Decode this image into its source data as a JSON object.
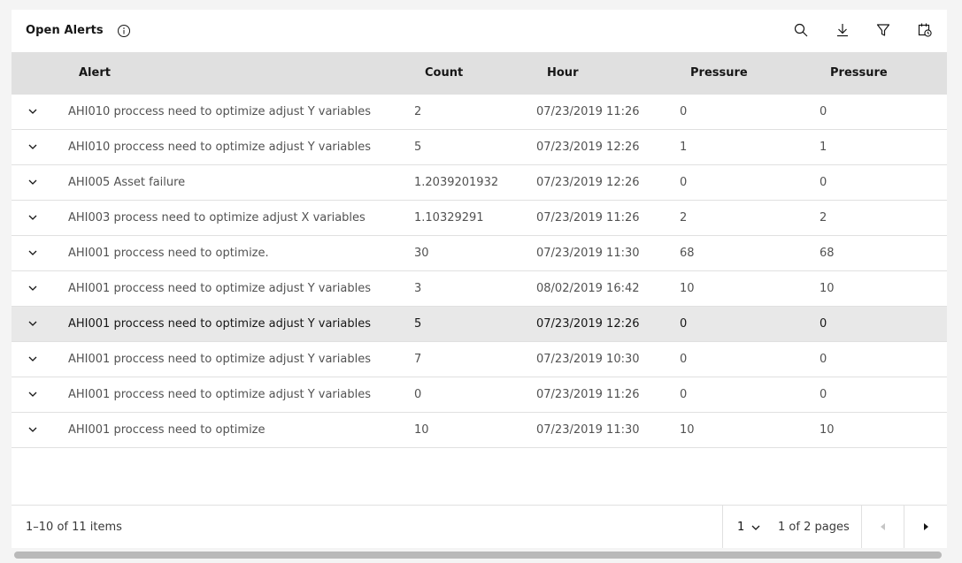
{
  "header": {
    "title": "Open Alerts",
    "toolbar_icons": [
      "info-icon",
      "search-icon",
      "download-icon",
      "filter-icon",
      "calendar-clock-icon"
    ]
  },
  "table": {
    "columns": [
      "Alert",
      "Count",
      "Hour",
      "Pressure",
      "Pressure"
    ],
    "rows": [
      {
        "alert": "AHI010 proccess need to optimize adjust Y variables",
        "count": "2",
        "hour": "07/23/2019 11:26",
        "pressure1": "0",
        "pressure2": "0"
      },
      {
        "alert": "AHI010 proccess need to optimize adjust Y variables",
        "count": "5",
        "hour": "07/23/2019 12:26",
        "pressure1": "1",
        "pressure2": "1"
      },
      {
        "alert": "AHI005 Asset failure",
        "count": "1.2039201932",
        "hour": "07/23/2019 12:26",
        "pressure1": "0",
        "pressure2": "0"
      },
      {
        "alert": "AHI003 process need to optimize adjust X variables",
        "count": "1.10329291",
        "hour": "07/23/2019 11:26",
        "pressure1": "2",
        "pressure2": "2"
      },
      {
        "alert": "AHI001 proccess need to optimize.",
        "count": "30",
        "hour": "07/23/2019 11:30",
        "pressure1": "68",
        "pressure2": "68"
      },
      {
        "alert": "AHI001 proccess need to optimize adjust Y variables",
        "count": "3",
        "hour": "08/02/2019 16:42",
        "pressure1": "10",
        "pressure2": "10"
      },
      {
        "alert": "AHI001 proccess need to optimize adjust Y variables",
        "count": "5",
        "hour": "07/23/2019 12:26",
        "pressure1": "0",
        "pressure2": "0"
      },
      {
        "alert": "AHI001 proccess need to optimize adjust Y variables",
        "count": "7",
        "hour": "07/23/2019 10:30",
        "pressure1": "0",
        "pressure2": "0"
      },
      {
        "alert": "AHI001 proccess need to optimize adjust Y variables",
        "count": "0",
        "hour": "07/23/2019 11:26",
        "pressure1": "0",
        "pressure2": "0"
      },
      {
        "alert": "AHI001 proccess need to optimize",
        "count": "10",
        "hour": "07/23/2019 11:30",
        "pressure1": "10",
        "pressure2": "10"
      }
    ]
  },
  "pagination": {
    "items_label": "1–10 of 11 items",
    "page_value": "1",
    "pages_label": "1 of 2 pages"
  },
  "colors": {
    "header_bg": "#e0e0e0",
    "selected_row_bg": "#e8e8e8",
    "page_bg": "#f4f4f4"
  }
}
